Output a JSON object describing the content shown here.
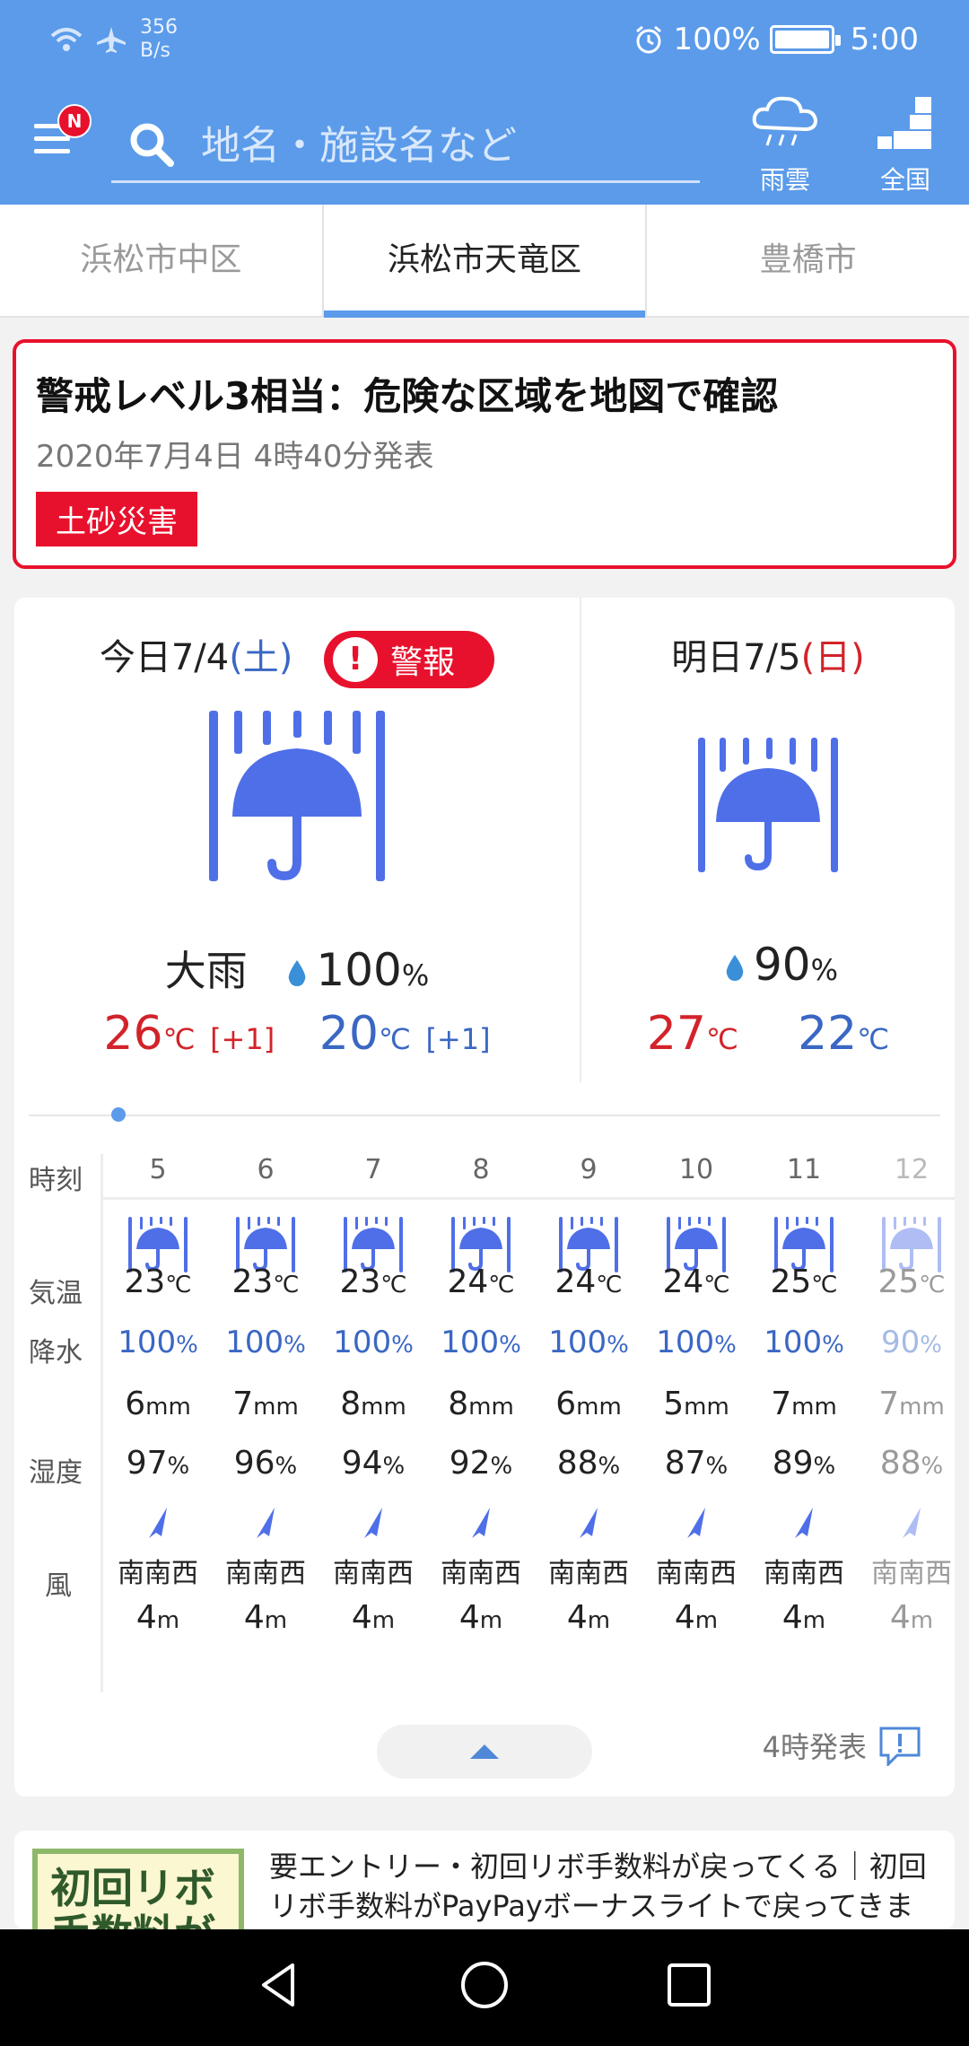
{
  "status_bar": {
    "net_speed_value": "356",
    "net_speed_unit": "B/s",
    "battery": "100%",
    "battery_level": 1.0,
    "time": "5:00"
  },
  "header": {
    "menu_badge": "N",
    "search_placeholder": "地名・施設名など",
    "rain_cloud_label": "雨雲",
    "nationwide_label": "全国"
  },
  "tabs": [
    {
      "label": "浜松市中区",
      "active": false
    },
    {
      "label": "浜松市天竜区",
      "active": true
    },
    {
      "label": "豊橋市",
      "active": false
    }
  ],
  "alert": {
    "title": "警戒レベル3相当：危険な区域を地図で確認",
    "issued": "2020年7月4日 4時40分発表",
    "tag": "土砂災害"
  },
  "today": {
    "label": "今日7/4",
    "weekday": "(土)",
    "warning": "警報",
    "warning_mark": "!",
    "condition": "大雨",
    "pop": "100",
    "pop_unit": "%",
    "high": "26",
    "high_diff": "[+1]",
    "low": "20",
    "low_diff": "[+1]",
    "temp_unit": "℃"
  },
  "tomorrow": {
    "label": "明日7/5",
    "weekday": "(日)",
    "pop": "90",
    "pop_unit": "%",
    "high": "27",
    "low": "22",
    "temp_unit": "℃"
  },
  "hourly": {
    "labels": {
      "time": "時刻",
      "temp": "気温",
      "precip": "降水",
      "humidity": "湿度",
      "wind": "風"
    },
    "units": {
      "temp": "℃",
      "pop": "%",
      "mm": "mm",
      "humidity": "%",
      "wind": "m"
    },
    "hours": [
      {
        "hour": "5",
        "temp": "23",
        "pop": "100",
        "mm": "6",
        "humidity": "97",
        "dir": "南南西",
        "speed": "4"
      },
      {
        "hour": "6",
        "temp": "23",
        "pop": "100",
        "mm": "7",
        "humidity": "96",
        "dir": "南南西",
        "speed": "4"
      },
      {
        "hour": "7",
        "temp": "23",
        "pop": "100",
        "mm": "8",
        "humidity": "94",
        "dir": "南南西",
        "speed": "4"
      },
      {
        "hour": "8",
        "temp": "24",
        "pop": "100",
        "mm": "8",
        "humidity": "92",
        "dir": "南南西",
        "speed": "4"
      },
      {
        "hour": "9",
        "temp": "24",
        "pop": "100",
        "mm": "6",
        "humidity": "88",
        "dir": "南南西",
        "speed": "4"
      },
      {
        "hour": "10",
        "temp": "24",
        "pop": "100",
        "mm": "5",
        "humidity": "87",
        "dir": "南南西",
        "speed": "4"
      },
      {
        "hour": "11",
        "temp": "25",
        "pop": "100",
        "mm": "7",
        "humidity": "89",
        "dir": "南南西",
        "speed": "4"
      },
      {
        "hour": "12",
        "temp": "25",
        "pop": "90",
        "mm": "7",
        "humidity": "88",
        "dir": "南南西",
        "speed": "4"
      }
    ],
    "issued": "4時発表"
  },
  "ad": {
    "thumb_text": "初回リボ手数料が",
    "text": "要エントリー・初回リボ手数料が戻ってくる｜初回リボ手数料がPayPayボーナスライトで戻ってきます。※ご入会時の会員..."
  },
  "colors": {
    "header_blue": "#5b9bea",
    "alert_red": "#e8112d",
    "umbrella_blue": "#4f6fe8",
    "temp_high": "#d2232a",
    "temp_low": "#3a67c4"
  }
}
